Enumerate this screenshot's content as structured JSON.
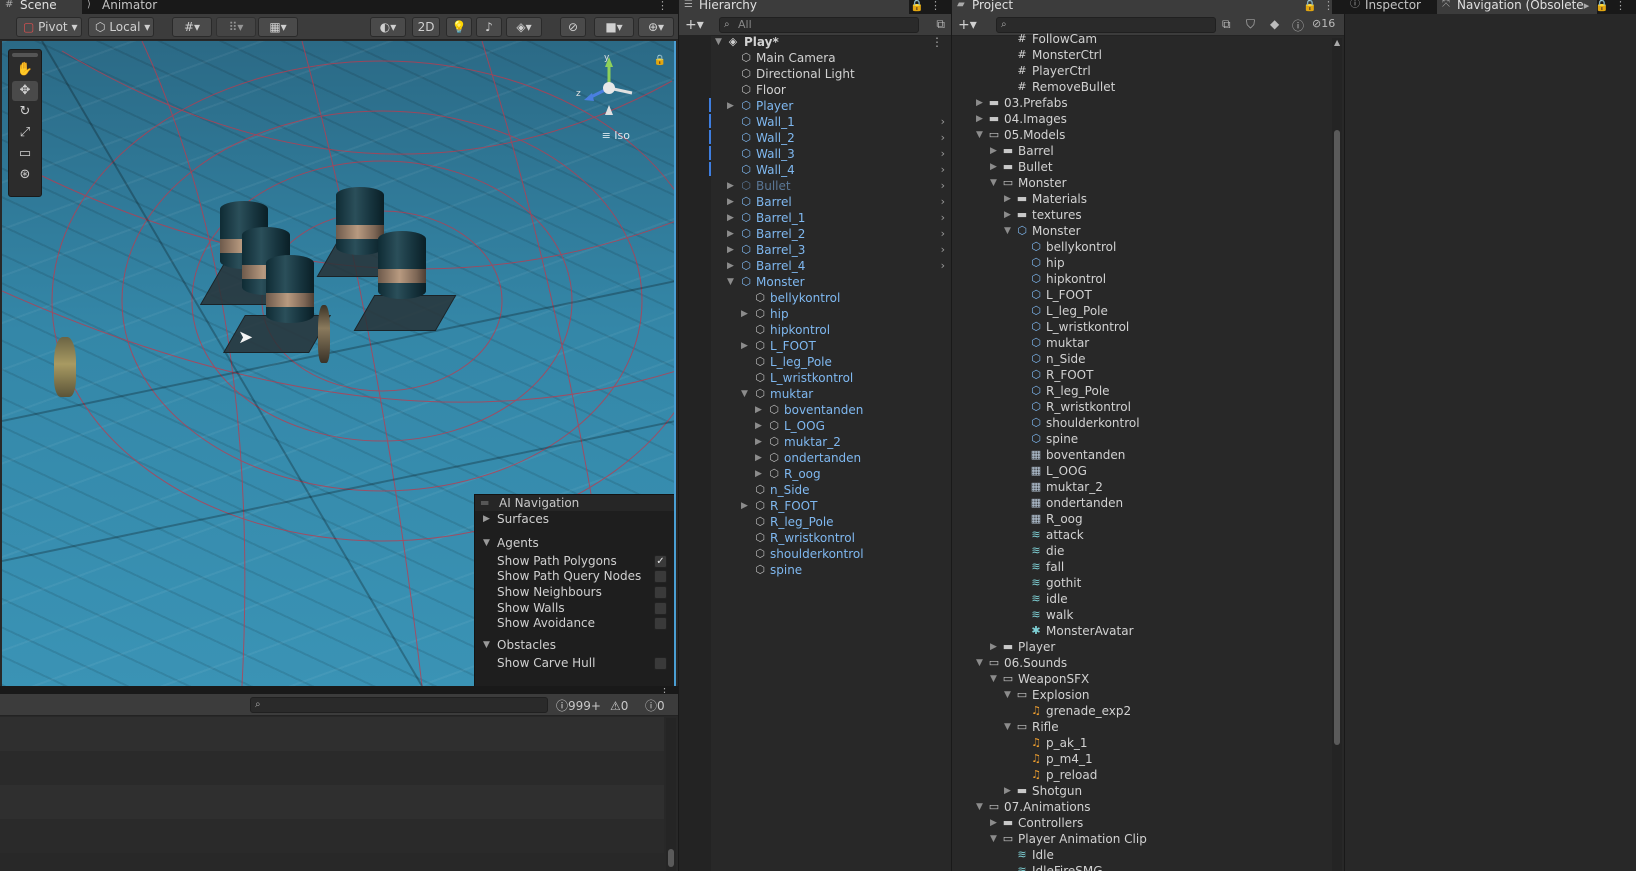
{
  "scene": {
    "tabs": [
      {
        "label": "Scene",
        "icon": "hash-icon"
      },
      {
        "label": "Animator",
        "icon": "animator-icon"
      }
    ],
    "toolbar": {
      "pivot": "Pivot",
      "local": "Local",
      "mode_2d": "2D"
    },
    "iso_label": "Iso",
    "gizmo": {
      "y": "y",
      "z": "z"
    },
    "ai_navigation": {
      "title": "AI Navigation",
      "surfaces": "Surfaces",
      "agents": "Agents",
      "agent_options": [
        {
          "label": "Show Path Polygons",
          "checked": true
        },
        {
          "label": "Show Path Query Nodes",
          "checked": false
        },
        {
          "label": "Show Neighbours",
          "checked": false
        },
        {
          "label": "Show Walls",
          "checked": false
        },
        {
          "label": "Show Avoidance",
          "checked": false
        }
      ],
      "obstacles": "Obstacles",
      "obstacle_options": [
        {
          "label": "Show Carve Hull",
          "checked": false
        }
      ]
    }
  },
  "console": {
    "errors": "999+",
    "warnings": "0",
    "messages": "0"
  },
  "hierarchy": {
    "tab": "Hierarchy",
    "search_placeholder": "All",
    "scene_name": "Play*",
    "items": [
      {
        "label": "Main Camera",
        "type": "go",
        "depth": 1
      },
      {
        "label": "Directional Light",
        "type": "go",
        "depth": 1
      },
      {
        "label": "Floor",
        "type": "go",
        "depth": 1
      },
      {
        "label": "Player",
        "type": "prefab",
        "depth": 1,
        "arrow": "right"
      },
      {
        "label": "Wall_1",
        "type": "prefab",
        "depth": 1,
        "chev": true
      },
      {
        "label": "Wall_2",
        "type": "prefab",
        "depth": 1,
        "chev": true
      },
      {
        "label": "Wall_3",
        "type": "prefab",
        "depth": 1,
        "chev": true
      },
      {
        "label": "Wall_4",
        "type": "prefab",
        "depth": 1,
        "chev": true
      },
      {
        "label": "Bullet",
        "type": "dimmed",
        "depth": 1,
        "arrow": "right",
        "chev": true
      },
      {
        "label": "Barrel",
        "type": "prefab",
        "depth": 1,
        "arrow": "right",
        "chev": true
      },
      {
        "label": "Barrel_1",
        "type": "prefab",
        "depth": 1,
        "arrow": "right",
        "chev": true
      },
      {
        "label": "Barrel_2",
        "type": "prefab",
        "depth": 1,
        "arrow": "right",
        "chev": true
      },
      {
        "label": "Barrel_3",
        "type": "prefab",
        "depth": 1,
        "arrow": "right",
        "chev": true
      },
      {
        "label": "Barrel_4",
        "type": "prefab",
        "depth": 1,
        "arrow": "right",
        "chev": true
      },
      {
        "label": "Monster",
        "type": "prefab",
        "depth": 1,
        "arrow": "down"
      },
      {
        "label": "bellykontrol",
        "type": "go",
        "depth": 2
      },
      {
        "label": "hip",
        "type": "go",
        "depth": 2,
        "arrow": "right"
      },
      {
        "label": "hipkontrol",
        "type": "go",
        "depth": 2
      },
      {
        "label": "L_FOOT",
        "type": "go",
        "depth": 2,
        "arrow": "right"
      },
      {
        "label": "L_leg_Pole",
        "type": "go",
        "depth": 2
      },
      {
        "label": "L_wristkontrol",
        "type": "go",
        "depth": 2
      },
      {
        "label": "muktar",
        "type": "go",
        "depth": 2,
        "arrow": "down"
      },
      {
        "label": "boventanden",
        "type": "go",
        "depth": 3,
        "arrow": "right"
      },
      {
        "label": "L_OOG",
        "type": "go",
        "depth": 3,
        "arrow": "right"
      },
      {
        "label": "muktar_2",
        "type": "go",
        "depth": 3,
        "arrow": "right"
      },
      {
        "label": "ondertanden",
        "type": "go",
        "depth": 3,
        "arrow": "right"
      },
      {
        "label": "R_oog",
        "type": "go",
        "depth": 3,
        "arrow": "right"
      },
      {
        "label": "n_Side",
        "type": "go",
        "depth": 2
      },
      {
        "label": "R_FOOT",
        "type": "go",
        "depth": 2,
        "arrow": "right"
      },
      {
        "label": "R_leg_Pole",
        "type": "go",
        "depth": 2
      },
      {
        "label": "R_wristkontrol",
        "type": "go",
        "depth": 2
      },
      {
        "label": "shoulderkontrol",
        "type": "go",
        "depth": 2
      },
      {
        "label": "spine",
        "type": "go",
        "depth": 2
      }
    ]
  },
  "project": {
    "tab": "Project",
    "hidden_count": "16",
    "items": [
      {
        "label": "FollowCam",
        "icon": "script",
        "depth": 3
      },
      {
        "label": "MonsterCtrl",
        "icon": "script",
        "depth": 3
      },
      {
        "label": "PlayerCtrl",
        "icon": "script",
        "depth": 3
      },
      {
        "label": "RemoveBullet",
        "icon": "script",
        "depth": 3
      },
      {
        "label": "03.Prefabs",
        "icon": "folder",
        "depth": 1,
        "arrow": "right"
      },
      {
        "label": "04.Images",
        "icon": "folder",
        "depth": 1,
        "arrow": "right"
      },
      {
        "label": "05.Models",
        "icon": "folder-open",
        "depth": 1,
        "arrow": "down"
      },
      {
        "label": "Barrel",
        "icon": "folder",
        "depth": 2,
        "arrow": "right"
      },
      {
        "label": "Bullet",
        "icon": "folder",
        "depth": 2,
        "arrow": "right"
      },
      {
        "label": "Monster",
        "icon": "folder-open",
        "depth": 2,
        "arrow": "down"
      },
      {
        "label": "Materials",
        "icon": "folder",
        "depth": 3,
        "arrow": "right"
      },
      {
        "label": "textures",
        "icon": "folder",
        "depth": 3,
        "arrow": "right"
      },
      {
        "label": "Monster",
        "icon": "model",
        "depth": 3,
        "arrow": "down"
      },
      {
        "label": "bellykontrol",
        "icon": "model",
        "depth": 4
      },
      {
        "label": "hip",
        "icon": "model",
        "depth": 4
      },
      {
        "label": "hipkontrol",
        "icon": "model",
        "depth": 4
      },
      {
        "label": "L_FOOT",
        "icon": "model",
        "depth": 4
      },
      {
        "label": "L_leg_Pole",
        "icon": "model",
        "depth": 4
      },
      {
        "label": "L_wristkontrol",
        "icon": "model",
        "depth": 4
      },
      {
        "label": "muktar",
        "icon": "model",
        "depth": 4
      },
      {
        "label": "n_Side",
        "icon": "model",
        "depth": 4
      },
      {
        "label": "R_FOOT",
        "icon": "model",
        "depth": 4
      },
      {
        "label": "R_leg_Pole",
        "icon": "model",
        "depth": 4
      },
      {
        "label": "R_wristkontrol",
        "icon": "model",
        "depth": 4
      },
      {
        "label": "shoulderkontrol",
        "icon": "model",
        "depth": 4
      },
      {
        "label": "spine",
        "icon": "model",
        "depth": 4
      },
      {
        "label": "boventanden",
        "icon": "mesh",
        "depth": 4
      },
      {
        "label": "L_OOG",
        "icon": "mesh",
        "depth": 4
      },
      {
        "label": "muktar_2",
        "icon": "mesh",
        "depth": 4
      },
      {
        "label": "ondertanden",
        "icon": "mesh",
        "depth": 4
      },
      {
        "label": "R_oog",
        "icon": "mesh",
        "depth": 4
      },
      {
        "label": "attack",
        "icon": "anim",
        "depth": 4
      },
      {
        "label": "die",
        "icon": "anim",
        "depth": 4
      },
      {
        "label": "fall",
        "icon": "anim",
        "depth": 4
      },
      {
        "label": "gothit",
        "icon": "anim",
        "depth": 4
      },
      {
        "label": "idle",
        "icon": "anim",
        "depth": 4
      },
      {
        "label": "walk",
        "icon": "anim",
        "depth": 4
      },
      {
        "label": "MonsterAvatar",
        "icon": "avatar",
        "depth": 4
      },
      {
        "label": "Player",
        "icon": "folder",
        "depth": 2,
        "arrow": "right"
      },
      {
        "label": "06.Sounds",
        "icon": "folder-open",
        "depth": 1,
        "arrow": "down"
      },
      {
        "label": "WeaponSFX",
        "icon": "folder-open",
        "depth": 2,
        "arrow": "down"
      },
      {
        "label": "Explosion",
        "icon": "folder-open",
        "depth": 3,
        "arrow": "down"
      },
      {
        "label": "grenade_exp2",
        "icon": "audio",
        "depth": 4
      },
      {
        "label": "Rifle",
        "icon": "folder-open",
        "depth": 3,
        "arrow": "down"
      },
      {
        "label": "p_ak_1",
        "icon": "audio",
        "depth": 4
      },
      {
        "label": "p_m4_1",
        "icon": "audio",
        "depth": 4
      },
      {
        "label": "p_reload",
        "icon": "audio",
        "depth": 4
      },
      {
        "label": "Shotgun",
        "icon": "folder",
        "depth": 3,
        "arrow": "right"
      },
      {
        "label": "07.Animations",
        "icon": "folder-open",
        "depth": 1,
        "arrow": "down"
      },
      {
        "label": "Controllers",
        "icon": "folder",
        "depth": 2,
        "arrow": "right"
      },
      {
        "label": "Player Animation Clip",
        "icon": "folder-open",
        "depth": 2,
        "arrow": "down"
      },
      {
        "label": "Idle",
        "icon": "anim",
        "depth": 3
      },
      {
        "label": "IdleFireSMG",
        "icon": "anim",
        "depth": 3
      }
    ]
  },
  "inspector": {
    "tabs": [
      "Inspector",
      "Navigation (Obsolete"
    ]
  },
  "colors": {
    "prefab": "#7fb8f0",
    "selection": "#4a9ed3",
    "folder": "#c8c8c8",
    "audio": "#f0a030",
    "anim": "#7fd1d6"
  }
}
